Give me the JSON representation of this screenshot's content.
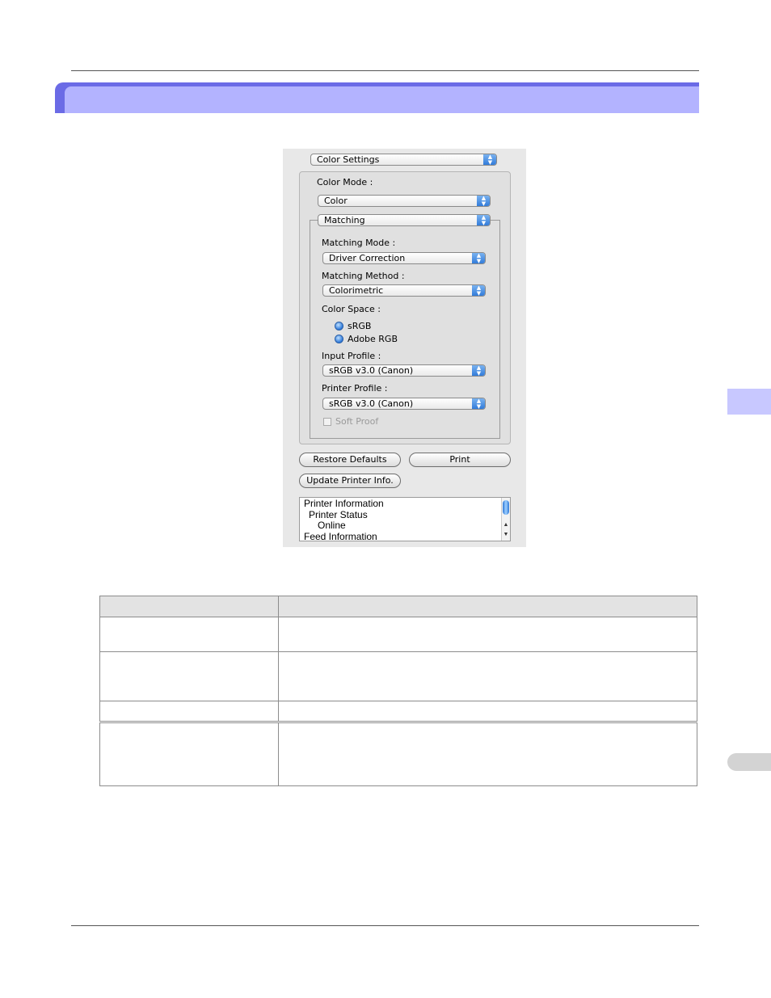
{
  "dialog": {
    "settings_popup": "Color Settings",
    "color_mode_label": "Color Mode :",
    "color_mode_value": "Color",
    "matching_popup": "Matching",
    "matching_mode_label": "Matching Mode :",
    "matching_mode_value": "Driver Correction",
    "matching_method_label": "Matching Method :",
    "matching_method_value": "Colorimetric",
    "color_space_label": "Color Space :",
    "color_space_options": [
      "sRGB",
      "Adobe RGB"
    ],
    "input_profile_label": "Input Profile :",
    "input_profile_value": "sRGB v3.0 (Canon)",
    "printer_profile_label": "Printer Profile :",
    "printer_profile_value": "sRGB v3.0 (Canon)",
    "soft_proof_label": "Soft Proof",
    "restore_defaults_label": "Restore Defaults",
    "print_label": "Print",
    "update_printer_info_label": "Update Printer Info.",
    "printer_info_lines": [
      "Printer Information",
      "Printer Status",
      "Online",
      "Feed Information"
    ]
  },
  "colors": {
    "banner_border": "#6b6be6",
    "banner_fill": "#b3b3ff",
    "side_tab": "#c8c8ff",
    "accent_blue": "#2d78d8"
  }
}
